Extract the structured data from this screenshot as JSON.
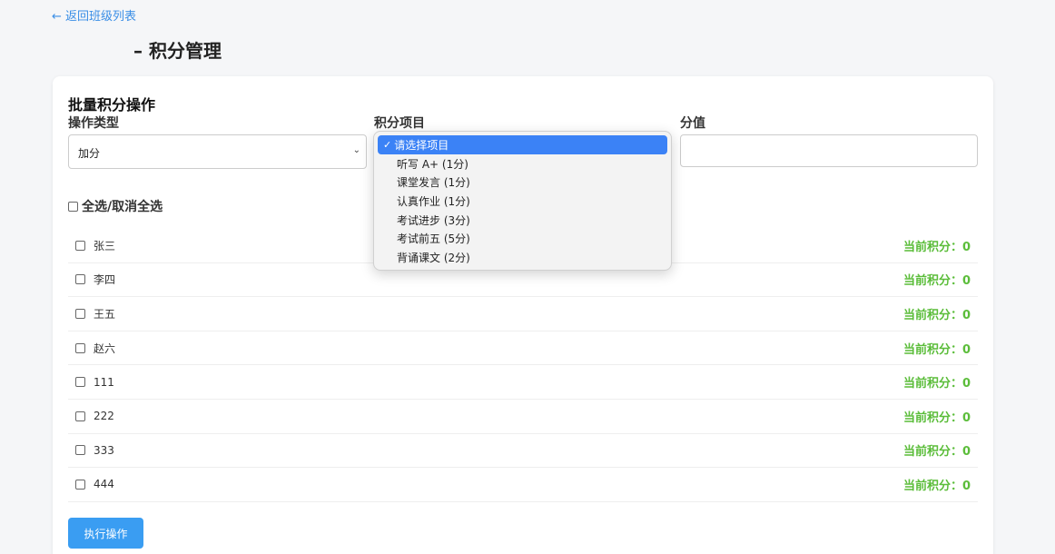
{
  "nav": {
    "back_label": "← 返回班级列表"
  },
  "page": {
    "title": "– 积分管理"
  },
  "batch": {
    "section_title": "批量积分操作",
    "op_type_label": "操作类型",
    "op_type_value": "加分",
    "item_label": "积分项目",
    "value_label": "分值",
    "value_input": ""
  },
  "dropdown": {
    "items": [
      {
        "label": "请选择项目",
        "selected": true
      },
      {
        "label": "听写 A+ (1分)"
      },
      {
        "label": "课堂发言 (1分)"
      },
      {
        "label": "认真作业 (1分)"
      },
      {
        "label": "考试进步 (3分)"
      },
      {
        "label": "考试前五 (5分)"
      },
      {
        "label": "背诵课文 (2分)"
      }
    ]
  },
  "select_all_label": "全选/取消全选",
  "students": [
    {
      "name": "张三",
      "score": "当前积分：0"
    },
    {
      "name": "李四",
      "score": "当前积分：0"
    },
    {
      "name": "王五",
      "score": "当前积分：0"
    },
    {
      "name": "赵六",
      "score": "当前积分：0"
    },
    {
      "name": "111",
      "score": "当前积分：0"
    },
    {
      "name": "222",
      "score": "当前积分：0"
    },
    {
      "name": "333",
      "score": "当前积分：0"
    },
    {
      "name": "444",
      "score": "当前积分：0"
    }
  ],
  "execute_label": "执行操作",
  "colors": {
    "accent": "#3a9df2",
    "score_green": "#5bbd3a",
    "selected_blue": "#3b82f6"
  }
}
